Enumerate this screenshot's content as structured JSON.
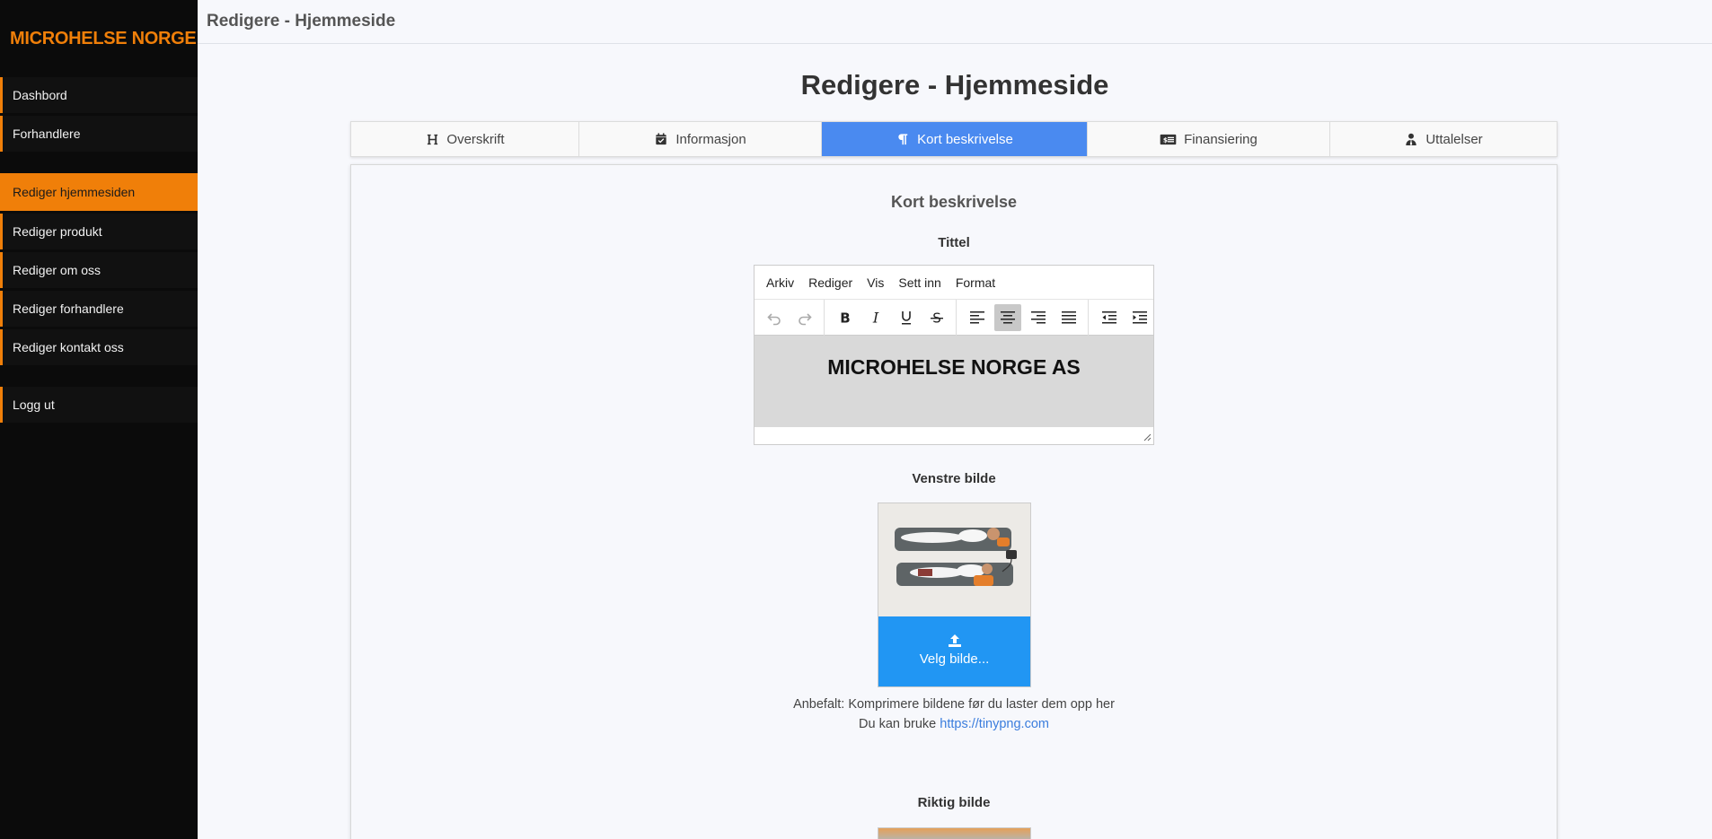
{
  "sidebar": {
    "brand": "MICROHELSE NORGE",
    "group1": [
      "Dashbord",
      "Forhandlere"
    ],
    "group2": [
      "Rediger hjemmesiden",
      "Rediger produkt",
      "Rediger om oss",
      "Rediger forhandlere",
      "Rediger kontakt oss"
    ],
    "group3": [
      "Logg ut"
    ],
    "active": "Rediger hjemmesiden"
  },
  "header": {
    "title": "Redigere - Hjemmeside"
  },
  "main": {
    "title": "Redigere - Hjemmeside",
    "tabs": [
      {
        "label": "Overskrift",
        "icon": "heading-icon"
      },
      {
        "label": "Informasjon",
        "icon": "calendar-check-icon"
      },
      {
        "label": "Kort beskrivelse",
        "icon": "paragraph-icon",
        "active": true
      },
      {
        "label": "Finansiering",
        "icon": "money-bill-icon"
      },
      {
        "label": "Uttalelser",
        "icon": "user-tie-icon"
      }
    ],
    "section_title": "Kort beskrivelse",
    "title_label": "Tittel",
    "editor": {
      "menu": [
        "Arkiv",
        "Rediger",
        "Vis",
        "Sett inn",
        "Format"
      ],
      "content": "MICROHELSE NORGE AS",
      "active_align": "center"
    },
    "left_image_label": "Venstre bilde",
    "upload_button": "Velg bilde...",
    "hint_line1": "Anbefalt: Komprimere bildene før du laster dem opp her",
    "hint_line2_prefix": "Du kan bruke",
    "hint_link": "https://tinypng.com",
    "right_image_label": "Riktig bilde"
  },
  "colors": {
    "accent": "#f07f09",
    "tab_active": "#4a8af0",
    "upload": "#2196f3",
    "sidebar_bg": "#0b0b0b"
  }
}
